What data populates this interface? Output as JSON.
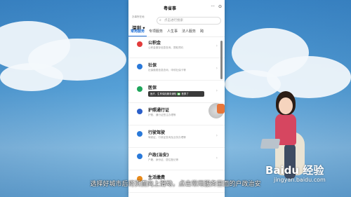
{
  "app": {
    "title": "粤省事",
    "more": "···",
    "target": "⊙"
  },
  "location": {
    "label": "办事所在地",
    "city": "深圳 ▾"
  },
  "search": {
    "placeholder": "点击进行搜索"
  },
  "tabs": [
    {
      "label": "常用服务"
    },
    {
      "label": "专项服务"
    },
    {
      "label": "人生事"
    },
    {
      "label": "法人服务"
    },
    {
      "label": "跨"
    }
  ],
  "services": [
    {
      "name": "公积金",
      "desc": "公积金缴存信息查询、提取预约",
      "color": "#e23b3b"
    },
    {
      "name": "社保",
      "desc": "社保缴费信息查询、申领社保卡等",
      "color": "#2a79d9"
    },
    {
      "name": "医保",
      "desc": "",
      "color": "#1fa65b"
    },
    {
      "name": "护照通行证",
      "desc": "护照、通行证签注办理等",
      "color": "#2b5fc9"
    },
    {
      "name": "行驶驾驶",
      "desc": "驾驶证、行驶证查询及业务办理等",
      "color": "#2a79d9"
    },
    {
      "name": "户政(治安)",
      "desc": "户籍、身份证、居住登记等",
      "color": "#2a79d9"
    },
    {
      "name": "生活缴费",
      "desc": "",
      "color": "#e88a1b"
    }
  ],
  "popup": {
    "text": "医疗、生育保险服务通知",
    "pill": "●",
    "action": "首屏了"
  },
  "caption": "选择好城市后将页面向上滑动，点击常用服务里面的户政治安",
  "watermark": {
    "brand": "Baidu 经验",
    "url": "jingyan.baidu.com"
  }
}
